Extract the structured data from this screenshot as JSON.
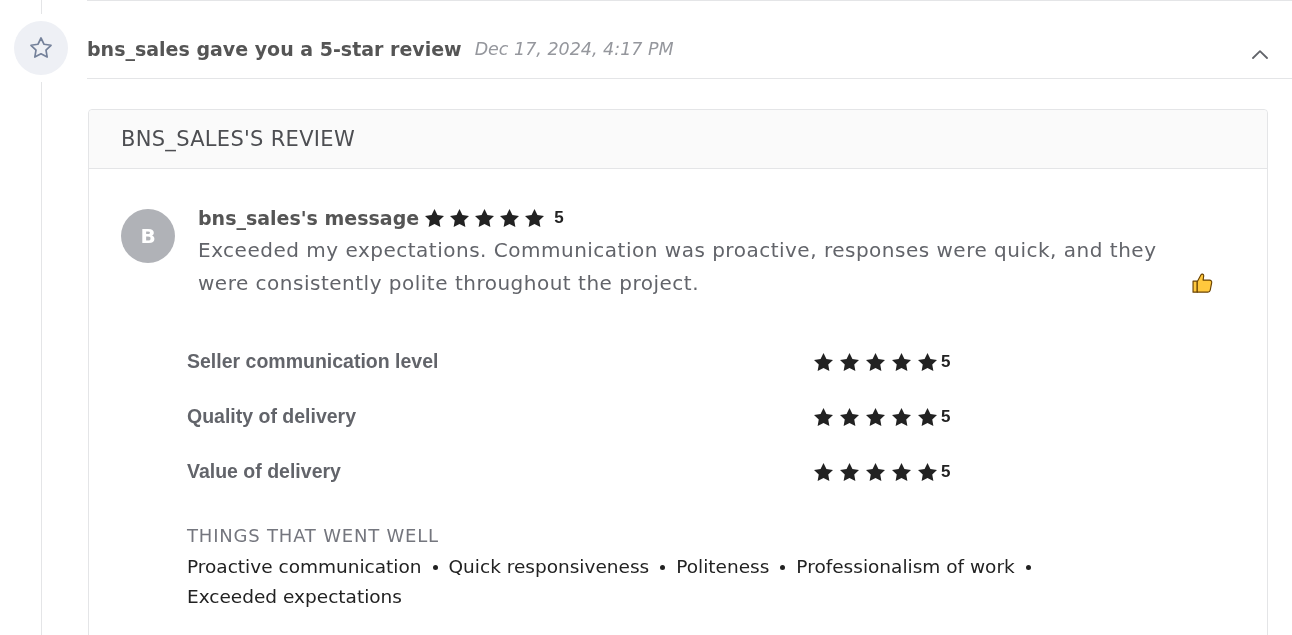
{
  "notification": {
    "title": "bns_sales gave you a 5-star review",
    "timestamp": "Dec 17, 2024, 4:17 PM",
    "expanded": true
  },
  "review": {
    "heading": "BNS_SALES'S REVIEW",
    "avatar_initial": "B",
    "author": "bns_sales's message",
    "stars": 5,
    "score": "5",
    "message": "Exceeded my expectations. Communication was proactive, responses were quick, and they were consistently polite throughout the project."
  },
  "ratings": [
    {
      "label": "Seller communication level",
      "stars": 5,
      "score": "5"
    },
    {
      "label": "Quality of delivery",
      "stars": 5,
      "score": "5"
    },
    {
      "label": "Value of delivery",
      "stars": 5,
      "score": "5"
    }
  ],
  "highlights": {
    "heading": "THINGS THAT WENT WELL",
    "items": [
      "Proactive communication",
      "Quick responsiveness",
      "Politeness",
      "Professionalism of work",
      "Exceeded expectations"
    ]
  }
}
